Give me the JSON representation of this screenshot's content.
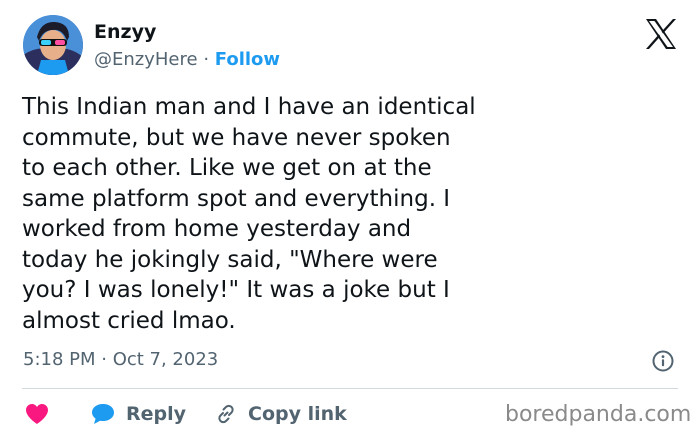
{
  "author": {
    "name": "Enzyy",
    "handle": "@EnzyHere",
    "separator": "·",
    "follow_label": "Follow"
  },
  "tweet": {
    "text": "This Indian man and I have an identical\ncommute, but we have never spoken\nto each other. Like we get on at the\nsame platform spot and everything. I\nworked from home yesterday and\ntoday he jokingly said, \"Where were\nyou? I was lonely!\" It was a joke but I\nalmost cried lmao.",
    "timestamp": "5:18 PM · Oct 7, 2023"
  },
  "actions": {
    "reply_label": "Reply",
    "copy_link_label": "Copy link"
  },
  "icons": {
    "platform_logo": "x-logo-icon",
    "info": "info-icon",
    "like": "heart-icon",
    "reply": "reply-bubble-icon",
    "copy_link": "link-icon"
  },
  "colors": {
    "text": "#0f1419",
    "secondary": "#536471",
    "accent": "#1d9bf0",
    "heart": "#f91880",
    "divider": "#cfd9de"
  },
  "watermark": "boredpanda.com"
}
